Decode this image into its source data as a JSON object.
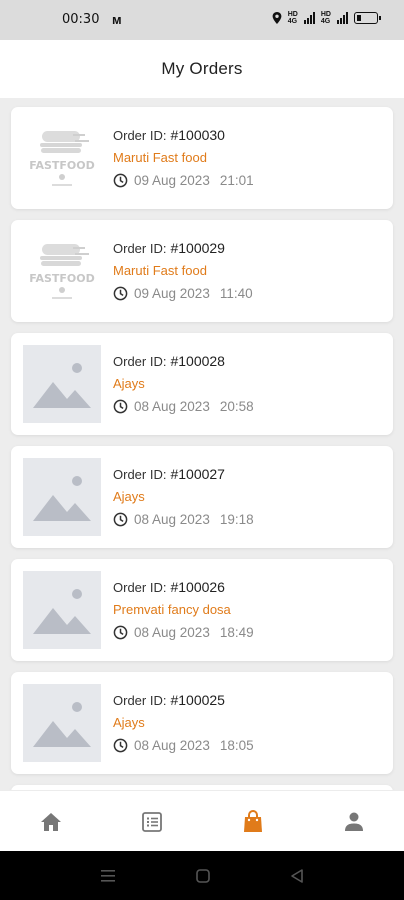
{
  "status_bar": {
    "time": "00:30",
    "notification_icon": "m-icon",
    "icons": [
      "location-icon",
      "hd-icon",
      "signal-icon",
      "hd-icon",
      "signal-icon",
      "battery-icon"
    ]
  },
  "header": {
    "title": "My Orders"
  },
  "labels": {
    "order_id": "Order ID:"
  },
  "colors": {
    "accent": "#E07B1A",
    "placeholder_bg": "#E6E8EC",
    "background": "#EDEDED"
  },
  "orders": [
    {
      "id": "#100030",
      "restaurant": "Maruti Fast food",
      "date": "09 Aug 2023",
      "time": "21:01",
      "image": "fast-food-logo"
    },
    {
      "id": "#100029",
      "restaurant": "Maruti Fast food",
      "date": "09 Aug 2023",
      "time": "11:40",
      "image": "fast-food-logo"
    },
    {
      "id": "#100028",
      "restaurant": "Ajays",
      "date": "08 Aug 2023",
      "time": "20:58",
      "image": "image-placeholder-icon"
    },
    {
      "id": "#100027",
      "restaurant": "Ajays",
      "date": "08 Aug 2023",
      "time": "19:18",
      "image": "image-placeholder-icon"
    },
    {
      "id": "#100026",
      "restaurant": "Premvati fancy dosa",
      "date": "08 Aug 2023",
      "time": "18:49",
      "image": "image-placeholder-icon"
    },
    {
      "id": "#100025",
      "restaurant": "Ajays",
      "date": "08 Aug 2023",
      "time": "18:05",
      "image": "image-placeholder-icon"
    }
  ],
  "logo": {
    "text": "FASTFOOD"
  },
  "bottom_nav": {
    "items": [
      {
        "icon": "home-icon",
        "active": false
      },
      {
        "icon": "list-icon",
        "active": false
      },
      {
        "icon": "shopping-bag-icon",
        "active": true
      },
      {
        "icon": "profile-icon",
        "active": false
      }
    ]
  },
  "system_nav": [
    "menu-icon",
    "home-square-icon",
    "back-icon"
  ]
}
